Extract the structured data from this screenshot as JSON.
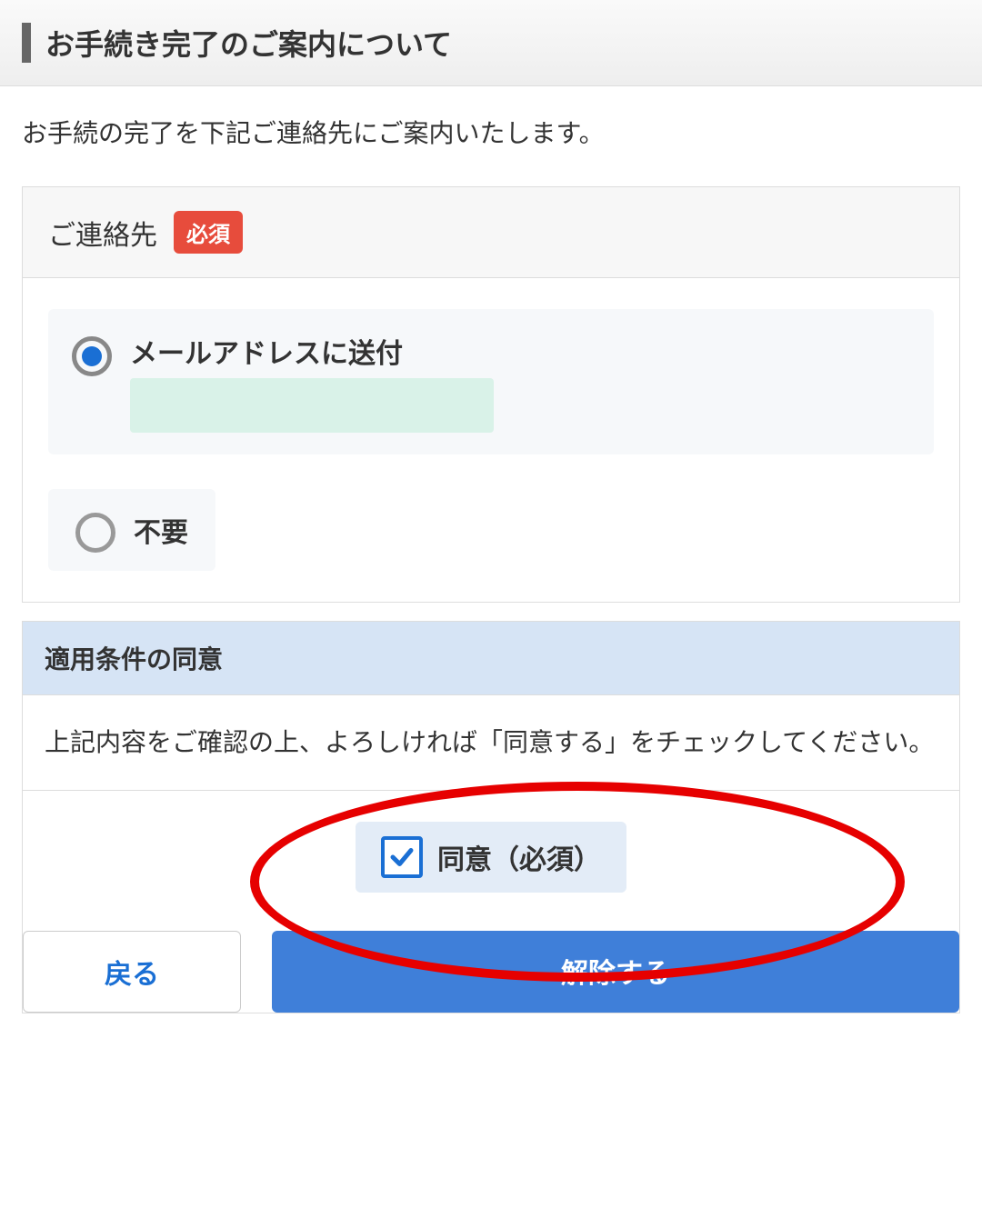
{
  "header": {
    "title": "お手続き完了のご案内について"
  },
  "intro": "お手続の完了を下記ご連絡先にご案内いたします。",
  "contact": {
    "section_title": "ご連絡先",
    "required_label": "必須",
    "options": {
      "email": {
        "label": "メールアドレスに送付",
        "value": ""
      },
      "none": {
        "label": "不要"
      }
    }
  },
  "consent": {
    "title": "適用条件の同意",
    "body": "上記内容をご確認の上、よろしければ「同意する」をチェックしてください。",
    "checkbox_label": "同意（必須）"
  },
  "buttons": {
    "back": "戻る",
    "submit": "解除する"
  }
}
